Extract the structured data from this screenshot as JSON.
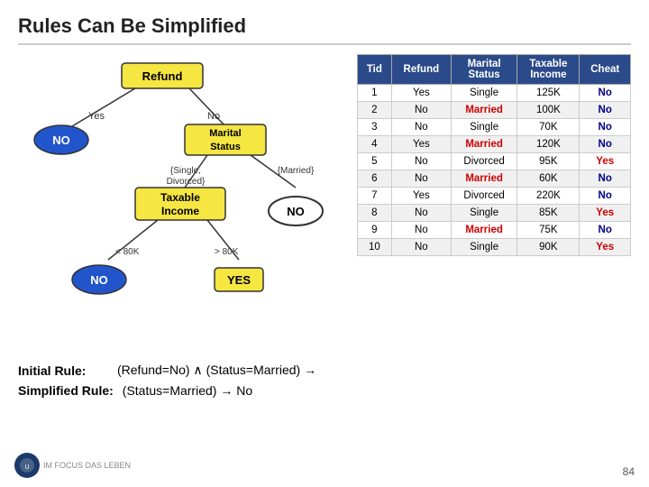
{
  "page": {
    "title": "Rules Can Be Simplified",
    "page_number": "84"
  },
  "diagram": {
    "nodes": {
      "refund": "Refund",
      "no_left": "NO",
      "marital_status": "Marital Status",
      "taxable_income": "Taxable Income",
      "no_bottom_left": "NO",
      "yes_bottom": "YES",
      "no_right": "NO",
      "yes_label": "Yes",
      "no_label": "No",
      "single_divorced": "{Single, Divorced}",
      "married": "{Married}",
      "less80k": "< 80K",
      "more80k": "> 80K"
    }
  },
  "table": {
    "headers": [
      "Tid",
      "Refund",
      "Marital Status",
      "Taxable Income",
      "Cheat"
    ],
    "rows": [
      {
        "tid": 1,
        "refund": "Yes",
        "marital_status": "Single",
        "taxable_income": "125K",
        "cheat": "No",
        "married": false,
        "cheat_yes": false
      },
      {
        "tid": 2,
        "refund": "No",
        "marital_status": "Married",
        "taxable_income": "100K",
        "cheat": "No",
        "married": true,
        "cheat_yes": false
      },
      {
        "tid": 3,
        "refund": "No",
        "marital_status": "Single",
        "taxable_income": "70K",
        "cheat": "No",
        "married": false,
        "cheat_yes": false
      },
      {
        "tid": 4,
        "refund": "Yes",
        "marital_status": "Married",
        "taxable_income": "120K",
        "cheat": "No",
        "married": true,
        "cheat_yes": false
      },
      {
        "tid": 5,
        "refund": "No",
        "marital_status": "Divorced",
        "taxable_income": "95K",
        "cheat": "Yes",
        "married": false,
        "cheat_yes": true
      },
      {
        "tid": 6,
        "refund": "No",
        "marital_status": "Married",
        "taxable_income": "60K",
        "cheat": "No",
        "married": true,
        "cheat_yes": false
      },
      {
        "tid": 7,
        "refund": "Yes",
        "marital_status": "Divorced",
        "taxable_income": "220K",
        "cheat": "No",
        "married": false,
        "cheat_yes": false
      },
      {
        "tid": 8,
        "refund": "No",
        "marital_status": "Single",
        "taxable_income": "85K",
        "cheat": "Yes",
        "married": false,
        "cheat_yes": true
      },
      {
        "tid": 9,
        "refund": "No",
        "marital_status": "Married",
        "taxable_income": "75K",
        "cheat": "No",
        "married": true,
        "cheat_yes": false
      },
      {
        "tid": 10,
        "refund": "No",
        "marital_status": "Single",
        "taxable_income": "90K",
        "cheat": "Yes",
        "married": false,
        "cheat_yes": true
      }
    ]
  },
  "bottom": {
    "initial_rule_label": "Initial Rule:",
    "initial_rule_formula": "(Refund=No) ∧ (Status=Married) →",
    "simplified_rule_label": "Simplified Rule:",
    "simplified_rule_formula": "(Status=Married) → No"
  },
  "logo": {
    "text": "IM FOCUS DAS LEBEN"
  }
}
